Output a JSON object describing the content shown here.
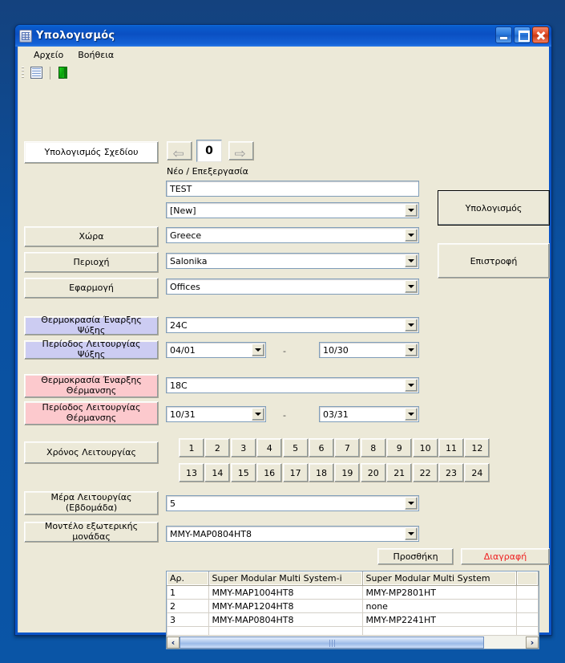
{
  "window": {
    "title": "Υπολογισμός",
    "title_icon": "grid-document-icon",
    "minimize_label": "",
    "maximize_label": "",
    "close_label": ""
  },
  "menu": {
    "items": [
      {
        "label": "Αρχείο"
      },
      {
        "label": "Βοήθεια"
      }
    ]
  },
  "toolbar": {
    "buttons": [
      {
        "icon": "grid-table-icon"
      },
      {
        "icon": "green-export-icon"
      }
    ]
  },
  "form": {
    "plan_calc_label": "Υπολογισμός Σχεδίου",
    "record_number": "0",
    "prev_icon": "arrow-left-icon",
    "next_icon": "arrow-right-icon",
    "new_edit_label": "Νέο / Επεξεργασία",
    "name_value": "TEST",
    "record_select_value": "[New]",
    "country_label": "Χώρα",
    "country_value": "Greece",
    "region_label": "Περιοχή",
    "region_value": "Salonika",
    "application_label": "Εφαρμογή",
    "application_value": "Offices",
    "cooling_temp_label": "Θερμοκρασία Έναρξης Ψύξης",
    "cooling_temp_value": "24C",
    "cooling_period_label": "Περίοδος Λειτουργίας Ψύξης",
    "cooling_from": "04/01",
    "cooling_to": "10/30",
    "heating_temp_label": "Θερμοκρασία Έναρξης Θέρμανσης",
    "heating_temp_value": "18C",
    "heating_period_label": "Περίοδος Λειτουργίας Θέρμανσης",
    "heating_from": "10/31",
    "heating_to": "03/31",
    "range_dash": "-",
    "operating_hours_label": "Χρόνος Λειτουργίας",
    "hours": [
      "1",
      "2",
      "3",
      "4",
      "5",
      "6",
      "7",
      "8",
      "9",
      "10",
      "11",
      "12",
      "13",
      "14",
      "15",
      "16",
      "17",
      "18",
      "19",
      "20",
      "21",
      "22",
      "23",
      "24"
    ],
    "operating_days_label": "Μέρα Λειτουργίας\n(Εβδομάδα)",
    "operating_days_label_line1": "Μέρα Λειτουργίας",
    "operating_days_label_line2": "(Εβδομάδα)",
    "operating_days_value": "5",
    "outdoor_model_label": "Μοντέλο εξωτερικής μονάδας",
    "outdoor_model_value": "MMY-MAP0804HT8",
    "calculate_button": "Υπολογισμός",
    "return_button": "Επιστροφή",
    "add_button": "Προσθήκη",
    "delete_button": "Διαγραφή"
  },
  "grid": {
    "columns": [
      "Αρ.",
      "Super Modular Multi System-i",
      "Super Modular Multi System",
      ""
    ],
    "rows": [
      {
        "no": "1",
        "smmsi": "MMY-MAP1004HT8",
        "smms": "MMY-MP2801HT",
        "extra": ""
      },
      {
        "no": "2",
        "smmsi": "MMY-MAP1204HT8",
        "smms": "none",
        "extra": ""
      },
      {
        "no": "3",
        "smmsi": "MMY-MAP0804HT8",
        "smms": "MMY-MP2241HT",
        "extra": ""
      }
    ],
    "scroll_left_icon": "chevron-left-icon",
    "scroll_right_icon": "chevron-right-icon"
  },
  "colors": {
    "cooling_label_bg": "#ccccf2",
    "heating_label_bg": "#fcc9cd",
    "delete_text": "#ef2020",
    "window_bg": "#ece9d8",
    "titlebar": "#0a5ccd",
    "desktop": "#0a55a6"
  }
}
